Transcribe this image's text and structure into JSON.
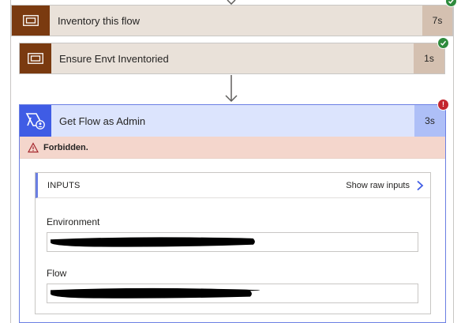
{
  "steps": [
    {
      "title": "Inventory this flow",
      "duration": "7s",
      "status": "succeeded",
      "icon": "scope-icon"
    },
    {
      "title": "Ensure Envt Inventoried",
      "duration": "1s",
      "status": "succeeded",
      "icon": "scope-icon"
    }
  ],
  "expanded_step": {
    "title": "Get Flow as Admin",
    "duration": "3s",
    "status": "failed",
    "icon": "power-automate-admin-icon",
    "error_message": "Forbidden.",
    "inputs": {
      "header": "INPUTS",
      "show_raw_label": "Show raw inputs",
      "fields": [
        {
          "label": "Environment",
          "value_redacted": true
        },
        {
          "label": "Flow",
          "value_redacted": true
        }
      ]
    }
  },
  "colors": {
    "scope_icon_bg": "#7a3a10",
    "scope_card_bg": "#e9e1d9",
    "scope_duration_bg": "#d4c0b0",
    "success": "#2e8b3d",
    "error": "#c4262e",
    "admin_icon_bg": "#3f5ce5",
    "admin_header_bg": "#dce4fd",
    "admin_duration_bg": "#aebff7",
    "error_bar_bg": "#f4d6cc",
    "accent": "#6b7fe3"
  }
}
